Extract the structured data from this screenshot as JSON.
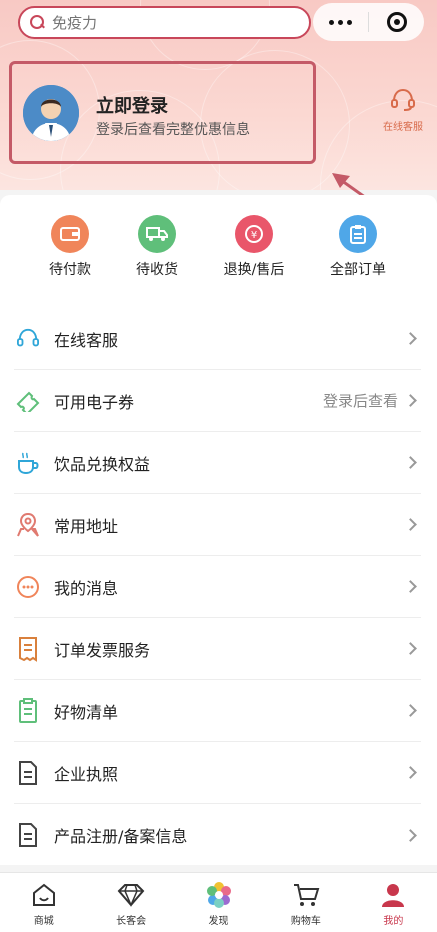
{
  "search": {
    "placeholder": "免疫力"
  },
  "login": {
    "title": "立即登录",
    "subtitle": "登录后查看完整优惠信息"
  },
  "service": {
    "label": "在线客服"
  },
  "orders": [
    {
      "label": "待付款",
      "color": "#f0855a",
      "icon": "wallet-icon"
    },
    {
      "label": "待收货",
      "color": "#5fbf7a",
      "icon": "truck-icon"
    },
    {
      "label": "退换/售后",
      "color": "#e9566a",
      "icon": "refund-icon"
    },
    {
      "label": "全部订单",
      "color": "#4fa7e8",
      "icon": "clipboard-icon"
    }
  ],
  "menu": [
    {
      "label": "在线客服",
      "value": "",
      "icon": "headset-icon"
    },
    {
      "label": "可用电子券",
      "value": "登录后查看",
      "icon": "ticket-icon"
    },
    {
      "label": "饮品兑换权益",
      "value": "",
      "icon": "cup-icon"
    },
    {
      "label": "常用地址",
      "value": "",
      "icon": "location-icon"
    },
    {
      "label": "我的消息",
      "value": "",
      "icon": "message-icon"
    },
    {
      "label": "订单发票服务",
      "value": "",
      "icon": "invoice-icon"
    },
    {
      "label": "好物清单",
      "value": "",
      "icon": "checklist-icon"
    },
    {
      "label": "企业执照",
      "value": "",
      "icon": "document-icon"
    },
    {
      "label": "产品注册/备案信息",
      "value": "",
      "icon": "document-icon"
    }
  ],
  "tabs": [
    {
      "label": "商城",
      "icon": "home-icon"
    },
    {
      "label": "长客会",
      "icon": "diamond-icon"
    },
    {
      "label": "发现",
      "icon": "flower-icon"
    },
    {
      "label": "购物车",
      "icon": "cart-icon"
    },
    {
      "label": "我的",
      "icon": "user-icon",
      "active": true
    }
  ],
  "colors": {
    "accent": "#c8374c",
    "hero": "#f8c9c4"
  }
}
